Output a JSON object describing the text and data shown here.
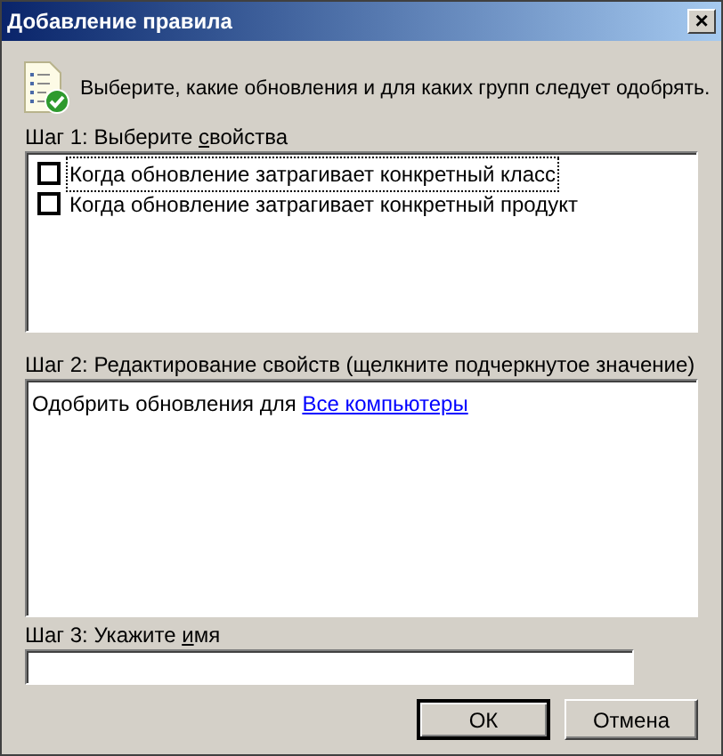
{
  "window": {
    "title": "Добавление правила",
    "close": "×"
  },
  "instruction": "Выберите, какие обновления и для каких групп следует одобрять.",
  "step1": {
    "label": {
      "before": "Шаг 1: Выберите ",
      "key": "с",
      "after": "войства"
    },
    "items": [
      {
        "label": "Когда обновление затрагивает конкретный класс",
        "checked": false,
        "focused": true
      },
      {
        "label": "Когда обновление затрагивает конкретный продукт",
        "checked": false,
        "focused": false
      }
    ]
  },
  "step2": {
    "label": {
      "before": "Шаг 2: Редактирование свойств (щелкните подчеркнутое значение)"
    },
    "text": "Одобрить обновления для",
    "link": "Все компьютеры"
  },
  "step3": {
    "label": {
      "before": "Шаг 3: Укажите ",
      "key": "и",
      "after": "мя"
    }
  },
  "buttons": [
    {
      "label": "ОК",
      "default": true
    },
    {
      "label": "Отмена",
      "default": false
    }
  ]
}
